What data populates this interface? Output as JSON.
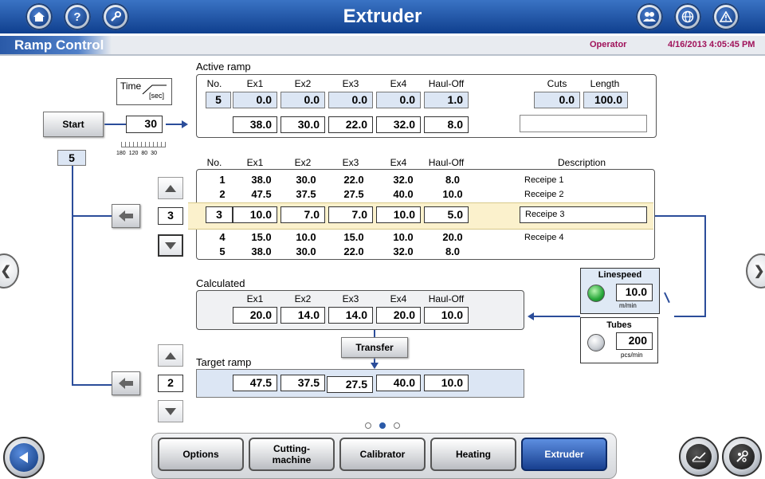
{
  "header": {
    "title": "Extruder",
    "left_icons": [
      "home-icon",
      "help-icon",
      "wrench-icon"
    ],
    "right_icons": [
      "users-icon",
      "globe-icon",
      "alarm-icon"
    ]
  },
  "subheader": {
    "title": "Ramp Control",
    "role": "Operator",
    "datetime": "4/16/2013 4:05:45 PM"
  },
  "time_widget": {
    "label": "Time",
    "unit": "[sec]",
    "value": "30",
    "scale_labels": [
      "180",
      "120",
      "80",
      "30"
    ]
  },
  "start_button": "Start",
  "start_counter": "5",
  "active_ramp": {
    "title": "Active ramp",
    "headers": [
      "No.",
      "Ex1",
      "Ex2",
      "Ex3",
      "Ex4",
      "Haul-Off"
    ],
    "no": "5",
    "current": [
      "0.0",
      "0.0",
      "0.0",
      "0.0",
      "1.0"
    ],
    "target": [
      "38.0",
      "30.0",
      "22.0",
      "32.0",
      "8.0"
    ],
    "cuts_label": "Cuts",
    "length_label": "Length",
    "cuts": "0.0",
    "length": "100.0",
    "description": ""
  },
  "recipe_table": {
    "headers": [
      "No.",
      "Ex1",
      "Ex2",
      "Ex3",
      "Ex4",
      "Haul-Off",
      "Description"
    ],
    "rows": [
      {
        "no": "1",
        "vals": [
          "38.0",
          "30.0",
          "22.0",
          "32.0",
          "8.0"
        ],
        "desc": "Receipe 1"
      },
      {
        "no": "2",
        "vals": [
          "47.5",
          "37.5",
          "27.5",
          "40.0",
          "10.0"
        ],
        "desc": "Receipe 2"
      },
      {
        "no": "3",
        "vals": [
          "10.0",
          "7.0",
          "7.0",
          "10.0",
          "5.0"
        ],
        "desc": "Receipe 3"
      },
      {
        "no": "4",
        "vals": [
          "15.0",
          "10.0",
          "15.0",
          "10.0",
          "20.0"
        ],
        "desc": "Receipe 4"
      },
      {
        "no": "5",
        "vals": [
          "38.0",
          "30.0",
          "22.0",
          "32.0",
          "8.0"
        ],
        "desc": ""
      }
    ],
    "selector_value": "3"
  },
  "calculated": {
    "title": "Calculated",
    "headers": [
      "Ex1",
      "Ex2",
      "Ex3",
      "Ex4",
      "Haul-Off"
    ],
    "values": [
      "20.0",
      "14.0",
      "14.0",
      "20.0",
      "10.0"
    ]
  },
  "linespeed": {
    "title": "Linespeed",
    "value": "10.0",
    "unit": "m/min",
    "led": "#28a83a"
  },
  "tubes": {
    "title": "Tubes",
    "value": "200",
    "unit": "pcs/min"
  },
  "transfer_button": "Transfer",
  "target_ramp": {
    "title": "Target ramp",
    "selector_value": "2",
    "values": [
      "47.5",
      "37.5",
      "27.5",
      "40.0",
      "10.0"
    ]
  },
  "footer": {
    "tabs": [
      "Options",
      "Cutting-\nmachine",
      "Calibrator",
      "Heating",
      "Extruder"
    ],
    "active_tab": 4,
    "page_dots": 3,
    "active_dot": 1,
    "right_icons": [
      "trend-chart-icon",
      "tools-icon"
    ]
  },
  "colors": {
    "accent": "#2b4d9a",
    "highlight_row": "#fbf1cc",
    "header_blue": "#0f3f8e"
  }
}
